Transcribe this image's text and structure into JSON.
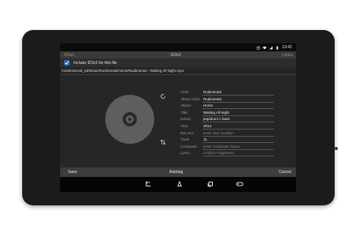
{
  "status_bar": {
    "icons": [
      "alarm-icon",
      "wifi-icon",
      "signal-icon",
      "battery-icon"
    ],
    "time": "13:42"
  },
  "action_bar": {
    "left": "ID3v1",
    "title": "ID3v2",
    "right": "Lyrics"
  },
  "include": {
    "checked": true,
    "label": "Include ID3v2 for this file"
  },
  "file_path": "/mnt/external_sd/Music/Rudimental/Home/Rudimental - Waiting All Night.mp3",
  "fields": [
    {
      "label": "Artist:",
      "value": "Rudimental",
      "placeholder": false
    },
    {
      "label": "Album Artist:",
      "value": "Rudimental",
      "placeholder": false
    },
    {
      "label": "Album:",
      "value": "Home",
      "placeholder": false
    },
    {
      "label": "Title:",
      "value": "Waiting All Night",
      "placeholder": false
    },
    {
      "label": "Genre:",
      "value": "pop/drum n bass",
      "placeholder": false
    },
    {
      "label": "Year:",
      "value": "2013",
      "placeholder": false
    },
    {
      "label": "Disc.No:",
      "value": "Enter Disc Number",
      "placeholder": true
    },
    {
      "label": "Track:",
      "value": "11",
      "placeholder": false
    },
    {
      "label": "Composer:",
      "value": "Enter Composer Name",
      "placeholder": true
    },
    {
      "label": "Lyrics:",
      "value": "Analyze Fragments",
      "placeholder": true
    }
  ],
  "bottom_bar": {
    "save": "Save",
    "autotag": "Autotag",
    "cancel": "Cancel"
  },
  "colors": {
    "accent": "#2a6aa8",
    "screen_bg": "#262626",
    "bezel": "#1b1b1c"
  }
}
